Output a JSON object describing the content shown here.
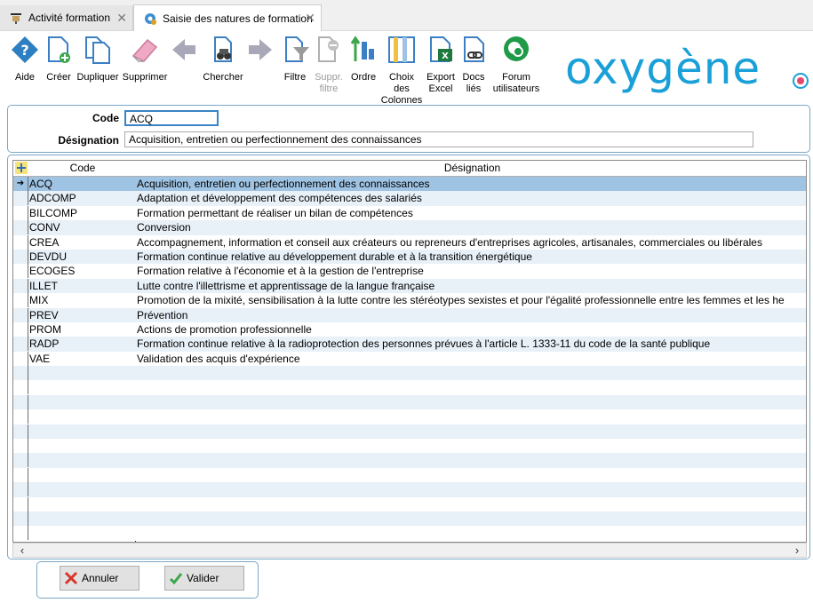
{
  "tabs": [
    {
      "label": "Activité formation",
      "icon": "training-icon"
    },
    {
      "label": "Saisie des natures de formation",
      "icon": "settings-gear-icon"
    }
  ],
  "toolbar": {
    "aide": "Aide",
    "creer": "Créer",
    "dupliquer": "Dupliquer",
    "supprimer": "Supprimer",
    "chercher": "Chercher",
    "filtre": "Filtre",
    "suppr_filtre_1": "Suppr.",
    "suppr_filtre_2": "filtre",
    "ordre": "Ordre",
    "choix_1": "Choix",
    "choix_2": "des",
    "choix_3": "Colonnes",
    "export_1": "Export",
    "export_2": "Excel",
    "docs_1": "Docs",
    "docs_2": "liés",
    "forum_1": "Forum",
    "forum_2": "utilisateurs"
  },
  "brand": {
    "logo_text": "oxygène",
    "accent": "#1aa0d8"
  },
  "form": {
    "code_label": "Code",
    "code_value": "ACQ",
    "designation_label": "Désignation",
    "designation_value": "Acquisition, entretien ou perfectionnement des connaissances"
  },
  "grid": {
    "col_code": "Code",
    "col_designation": "Désignation",
    "rows": [
      {
        "code": "ACQ",
        "designation": "Acquisition, entretien ou perfectionnement des connaissances"
      },
      {
        "code": "ADCOMP",
        "designation": "Adaptation et développement des compétences des salariés"
      },
      {
        "code": "BILCOMP",
        "designation": "Formation permettant de réaliser un bilan de compétences"
      },
      {
        "code": "CONV",
        "designation": "Conversion"
      },
      {
        "code": "CREA",
        "designation": "Accompagnement, information et conseil aux créateurs ou repreneurs d'entreprises agricoles, artisanales, commerciales ou libérales"
      },
      {
        "code": "DEVDU",
        "designation": "Formation continue relative au développement durable et à la transition énergétique"
      },
      {
        "code": "ECOGES",
        "designation": "Formation relative à l'économie et à la gestion de l'entreprise"
      },
      {
        "code": "ILLET",
        "designation": "Lutte contre l'illettrisme et apprentissage de la langue française"
      },
      {
        "code": "MIX",
        "designation": "Promotion de la mixité, sensibilisation à la lutte contre les stéréotypes sexistes et pour l'égalité professionnelle entre les femmes et les he"
      },
      {
        "code": "PREV",
        "designation": "Prévention"
      },
      {
        "code": "PROM",
        "designation": "Actions de promotion professionnelle"
      },
      {
        "code": "RADP",
        "designation": "Formation continue relative à la radioprotection des personnes prévues à l'article L. 1333-11 du code de la santé publique"
      },
      {
        "code": "VAE",
        "designation": "Validation des acquis d'expérience"
      }
    ],
    "selected_code": "ACQ"
  },
  "buttons": {
    "annuler": "Annuler",
    "valider": "Valider"
  }
}
